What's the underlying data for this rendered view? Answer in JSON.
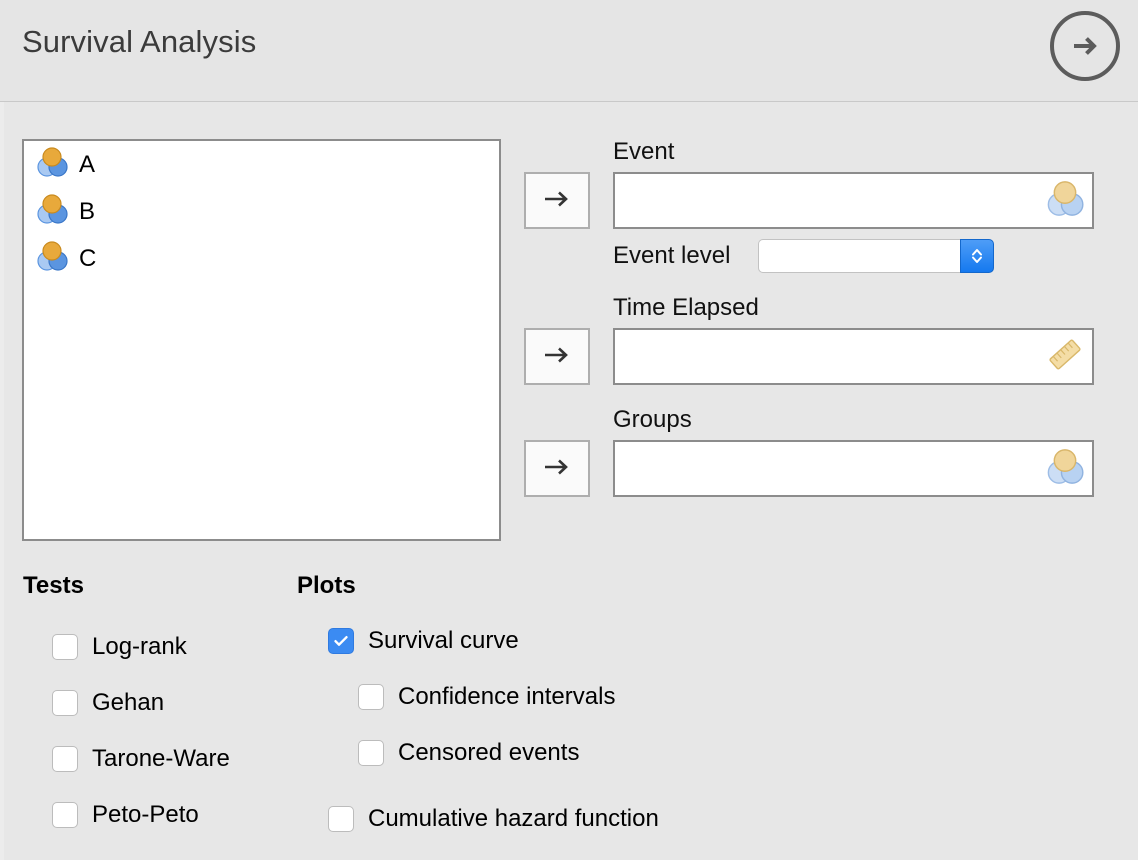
{
  "header": {
    "title": "Survival Analysis",
    "run_icon": "arrow-right-circle-icon"
  },
  "variables": {
    "items": [
      {
        "name": "A",
        "icon": "nominal-icon"
      },
      {
        "name": "B",
        "icon": "nominal-icon"
      },
      {
        "name": "C",
        "icon": "nominal-icon"
      }
    ]
  },
  "fields": {
    "event": {
      "label": "Event",
      "value": "",
      "transfer_icon": "arrow-right-icon",
      "watermark_icon": "nominal-icon"
    },
    "event_level": {
      "label": "Event level",
      "value": "",
      "stepper_icon": "chevron-up-down-icon",
      "options": []
    },
    "time_elapsed": {
      "label": "Time Elapsed",
      "value": "",
      "transfer_icon": "arrow-right-icon",
      "watermark_icon": "ruler-icon"
    },
    "groups": {
      "label": "Groups",
      "value": "",
      "transfer_icon": "arrow-right-icon",
      "watermark_icon": "nominal-icon"
    }
  },
  "tests": {
    "title": "Tests",
    "options": [
      {
        "label": "Log-rank",
        "checked": false
      },
      {
        "label": "Gehan",
        "checked": false
      },
      {
        "label": "Tarone-Ware",
        "checked": false
      },
      {
        "label": "Peto-Peto",
        "checked": false
      }
    ]
  },
  "plots": {
    "title": "Plots",
    "options": [
      {
        "label": "Survival curve",
        "checked": true
      },
      {
        "label": "Confidence intervals",
        "checked": false
      },
      {
        "label": "Censored events",
        "checked": false
      },
      {
        "label": "Cumulative hazard function",
        "checked": false
      }
    ]
  },
  "colors": {
    "background": "#e7e7e7",
    "accent_blue": "#3b8bf2",
    "icon_orange": "#e8a93b",
    "icon_blue_light": "#a7c7f0",
    "icon_blue": "#5b95e0",
    "title_text": "#3b3b3b"
  }
}
